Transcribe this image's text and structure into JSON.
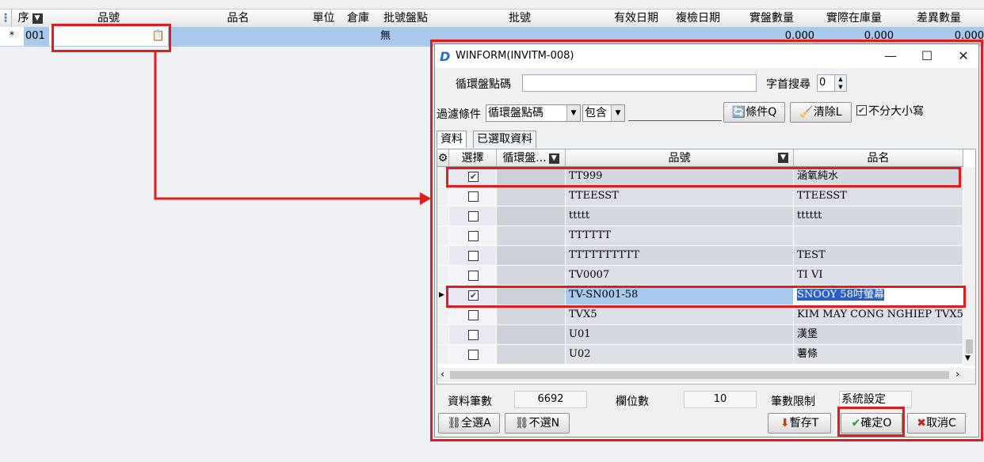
{
  "background_grid": {
    "columns": [
      "序",
      "品號",
      "品名",
      "單位",
      "倉庫",
      "批號盤點",
      "批號",
      "有效日期",
      "複檢日期",
      "實盤數量",
      "實際在庫量",
      "差異數量"
    ],
    "row": {
      "marker": "*",
      "seq": "001",
      "lot_check": "無",
      "qty1": "0.000",
      "qty2": "0.000",
      "qty3": "0.000"
    }
  },
  "dialog": {
    "title": "WINFORM(INVITM-008)",
    "window_buttons": {
      "minimize": "—",
      "maximize": "☐",
      "close": "✕"
    },
    "cycle_code_label": "循環盤點碼",
    "cycle_code_value": "",
    "first_char_search_label": "字首搜尋",
    "first_char_search_value": "0",
    "filter_label": "過濾條件",
    "filter_field": "循環盤點碼",
    "filter_op": "包含",
    "filter_value": "",
    "condition_button": "條件Q",
    "clear_button": "清除L",
    "case_insensitive_label": "不分大小寫",
    "case_insensitive_checked": true,
    "tabs": [
      "資料",
      "已選取資料"
    ],
    "grid": {
      "columns": [
        "選擇",
        "循環盤...",
        "品號",
        "品名"
      ],
      "rows": [
        {
          "checked": true,
          "code": "",
          "item_no": "TT999",
          "item_name": "涵氧純水"
        },
        {
          "checked": false,
          "code": "",
          "item_no": "TTEESST",
          "item_name": "TTEESST"
        },
        {
          "checked": false,
          "code": "",
          "item_no": "ttttt",
          "item_name": "tttttt"
        },
        {
          "checked": false,
          "code": "",
          "item_no": "TTTTTT",
          "item_name": ""
        },
        {
          "checked": false,
          "code": "",
          "item_no": "TTTTTTTTTT",
          "item_name": "TEST"
        },
        {
          "checked": false,
          "code": "",
          "item_no": "TV0007",
          "item_name": "TI VI"
        },
        {
          "checked": true,
          "code": "",
          "item_no": "TV-SN001-58",
          "item_name": "SNOOY 58吋螢幕"
        },
        {
          "checked": false,
          "code": "",
          "item_no": "TVX5",
          "item_name": "KIM MAY CONG NGHIEP TVX5"
        },
        {
          "checked": false,
          "code": "",
          "item_no": "U01",
          "item_name": "漢堡"
        },
        {
          "checked": false,
          "code": "",
          "item_no": "U02",
          "item_name": "薯條"
        }
      ],
      "current_row_index": 6
    },
    "record_count_label": "資料筆數",
    "record_count": "6692",
    "field_count_label": "欄位數",
    "field_count": "10",
    "limit_label": "筆數限制",
    "limit_value": "系統設定",
    "select_all_button": "全選A",
    "deselect_button": "不選N",
    "temp_save_button": "暫存T",
    "confirm_button": "確定O",
    "cancel_button": "取消C"
  },
  "colors": {
    "highlight": "#e31b1b",
    "selection": "#a8c8ec",
    "connector": "#e31b1b"
  }
}
